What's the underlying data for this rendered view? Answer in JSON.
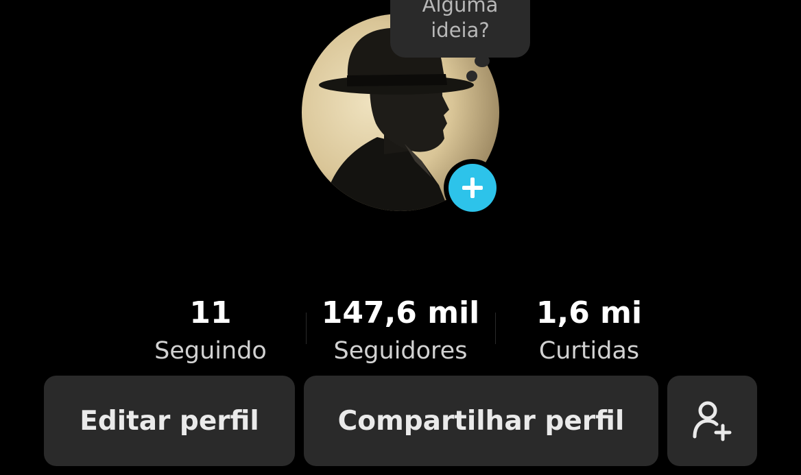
{
  "bubble": {
    "line1": "Alguma",
    "line2": "ideia?"
  },
  "avatar": {
    "icon": "profile-photo-man-in-hat-silhouette"
  },
  "add_button": {
    "icon": "plus-icon",
    "color": "#2dc3ea"
  },
  "stats": [
    {
      "value": "11",
      "label": "Seguindo"
    },
    {
      "value": "147,6 mil",
      "label": "Seguidores"
    },
    {
      "value": "1,6 mi",
      "label": "Curtidas"
    }
  ],
  "buttons": {
    "edit_label": "Editar perfil",
    "share_label": "Compartilhar perfil",
    "add_friend_icon": "add-person-icon"
  },
  "colors": {
    "background": "#000000",
    "button_bg": "#2a2a2a",
    "accent": "#2dc3ea"
  }
}
